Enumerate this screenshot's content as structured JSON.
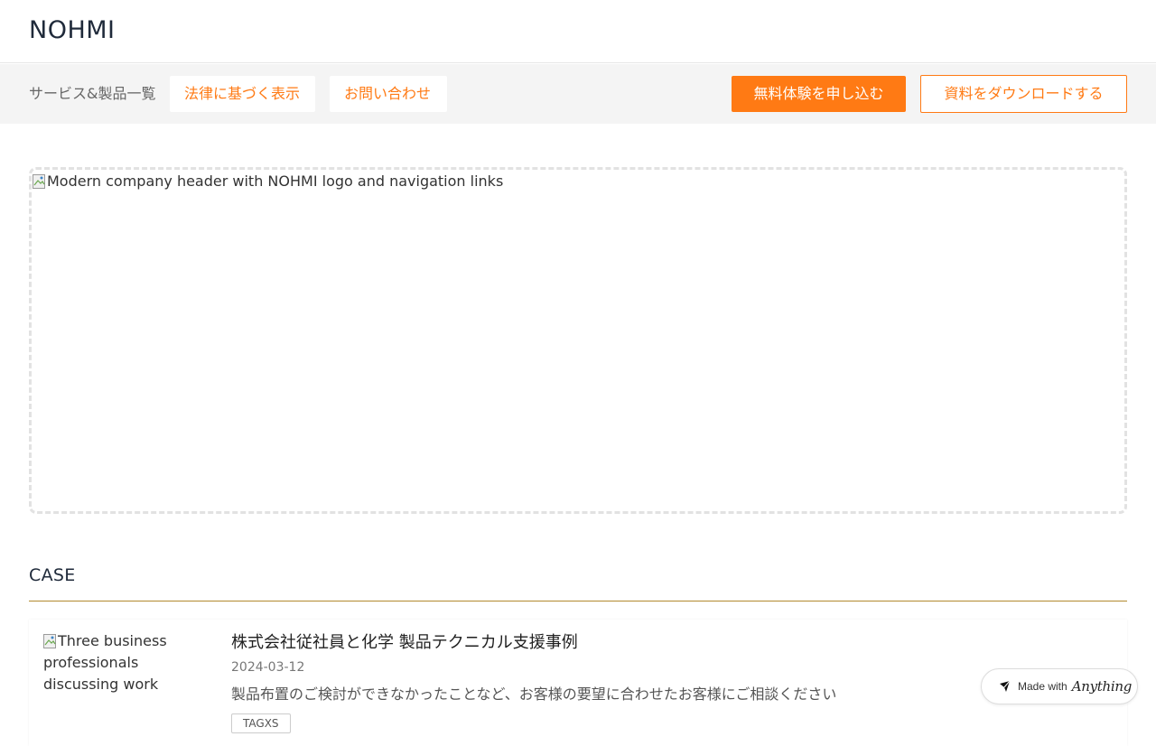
{
  "header": {
    "logo": "NOHMI"
  },
  "nav": {
    "label": "サービス&製品一覧",
    "legal_link": "法律に基づく表示",
    "contact_link": "お問い合わせ",
    "trial_button": "無料体験を申し込む",
    "download_button": "資料をダウンロードする"
  },
  "hero": {
    "image_alt": "Modern company header with NOHMI logo and navigation links"
  },
  "case_section": {
    "title": "CASE",
    "items": [
      {
        "image_alt": "Three business professionals discussing work",
        "heading": "株式会社従社員と化学 製品テクニカル支援事例",
        "date": "2024-03-12",
        "description": "製品布置のご検討ができなかったことなど、お客様の要望に合わせたお客様にご相談ください",
        "tag": "TAGXS"
      }
    ]
  },
  "badge": {
    "made_with": "Made with",
    "brand": "Anything"
  },
  "colors": {
    "accent": "#ff7a14",
    "rule": "#b28a2e",
    "nav_bg": "#f4f4f4"
  }
}
